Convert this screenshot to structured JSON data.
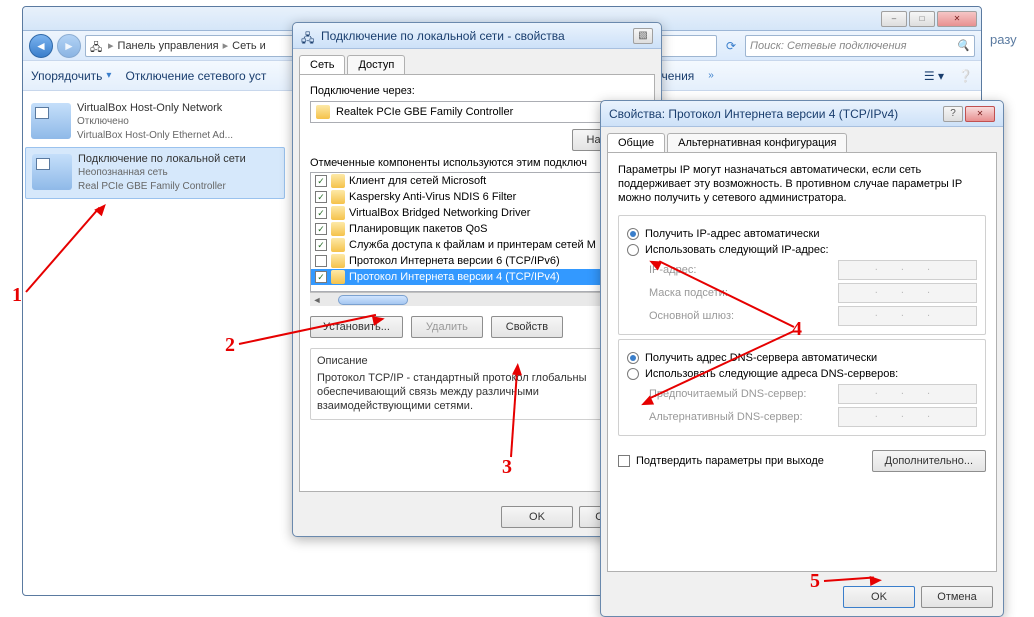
{
  "explorer": {
    "breadcrumb": {
      "item1": "Панель управления",
      "item2": "Сеть и",
      "sep": "▸"
    },
    "search_placeholder": "Поиск: Сетевые подключения",
    "toolbar": {
      "organize": "Упорядочить",
      "disable": "Отключение сетевого уст",
      "diagnose": "ключения",
      "chev": "»"
    },
    "aside_text": "разу"
  },
  "connections": [
    {
      "title": "VirtualBox Host-Only Network",
      "status": "Отключено",
      "adapter": "VirtualBox Host-Only Ethernet Ad..."
    },
    {
      "title": "Подключение по локальной сети",
      "status": "Неопознанная сеть",
      "adapter": "Real    PCIe GBE Family Controller"
    }
  ],
  "props": {
    "title": "Подключение по локальной сети - свойства",
    "tabs": {
      "net": "Сеть",
      "access": "Доступ"
    },
    "connect_via": "Подключение через:",
    "adapter": "Realtek PCIe GBE Family Controller",
    "configure": "Настрои",
    "components_label": "Отмеченные компоненты используются этим подключ",
    "components": [
      {
        "label": "Клиент для сетей Microsoft",
        "checked": true
      },
      {
        "label": "Kaspersky Anti-Virus NDIS 6 Filter",
        "checked": true
      },
      {
        "label": "VirtualBox Bridged Networking Driver",
        "checked": true
      },
      {
        "label": "Планировщик пакетов QoS",
        "checked": true
      },
      {
        "label": "Служба доступа к файлам и принтерам сетей M",
        "checked": true
      },
      {
        "label": "Протокол Интернета версии 6 (TCP/IPv6)",
        "checked": false
      },
      {
        "label": "Протокол Интернета версии 4 (TCP/IPv4)",
        "checked": true,
        "selected": true
      }
    ],
    "install": "Установить...",
    "remove": "Удалить",
    "properties": "Свойств",
    "desc_title": "Описание",
    "desc": "Протокол TCP/IP - стандартный протокол глобальны обеспечивающий связь между различными взаимодействующими сетями.",
    "ok": "OK",
    "cancel": "Отмена"
  },
  "ipv4": {
    "title": "Свойства: Протокол Интернета версии 4 (TCP/IPv4)",
    "tabs": {
      "general": "Общие",
      "alt": "Альтернативная конфигурация"
    },
    "intro": "Параметры IP могут назначаться автоматически, если сеть поддерживает эту возможность. В противном случае параметры IP можно получить у сетевого администратора.",
    "auto_ip": "Получить IP-адрес автоматически",
    "manual_ip": "Использовать следующий IP-адрес:",
    "ip_label": "IP-адрес:",
    "mask_label": "Маска подсети:",
    "gw_label": "Основной шлюз:",
    "auto_dns": "Получить адрес DNS-сервера автоматически",
    "manual_dns": "Использовать следующие адреса DNS-серверов:",
    "dns1": "Предпочитаемый DNS-сервер:",
    "dns2": "Альтернативный DNS-сервер:",
    "confirm": "Подтвердить параметры при выходе",
    "advanced": "Дополнительно...",
    "ok": "OK",
    "cancel": "Отмена",
    "dots": ".   .   ."
  },
  "labels": {
    "n1": "1",
    "n2": "2",
    "n3": "3",
    "n4": "4",
    "n5": "5"
  }
}
